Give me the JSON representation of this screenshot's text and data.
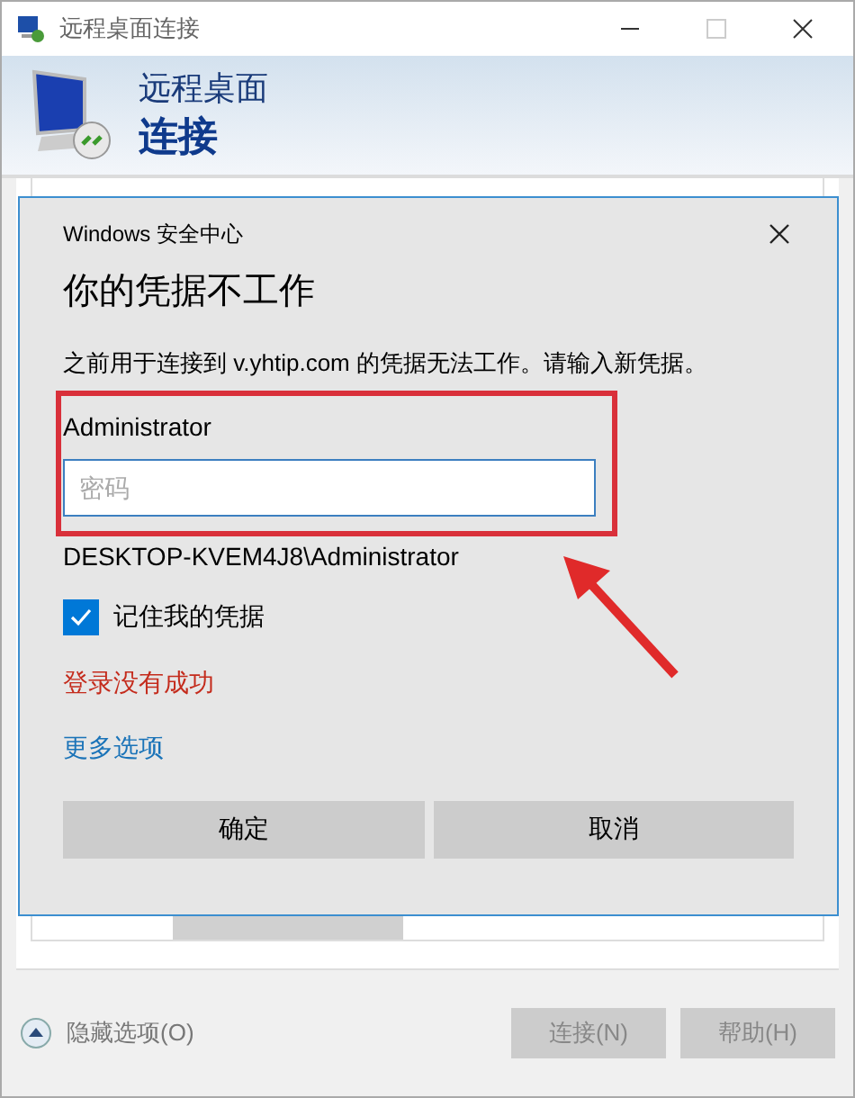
{
  "window": {
    "title": "远程桌面连接",
    "header_line1": "远程桌面",
    "header_line2": "连接"
  },
  "dialog": {
    "caption": "Windows 安全中心",
    "heading": "你的凭据不工作",
    "message": "之前用于连接到 v.yhtip.com 的凭据无法工作。请输入新凭据。",
    "username": "Administrator",
    "password": {
      "placeholder": "密码"
    },
    "account": "DESKTOP-KVEM4J8\\Administrator",
    "remember": {
      "label": "记住我的凭据",
      "checked": true
    },
    "error": "登录没有成功",
    "more_options": "更多选项",
    "buttons": [
      {
        "label": "确定"
      },
      {
        "label": "取消"
      }
    ]
  },
  "footer": {
    "toggle": "隐藏选项(O)",
    "buttons": [
      {
        "label": "连接(N)",
        "disabled": true
      },
      {
        "label": "帮助(H)",
        "disabled": true
      }
    ]
  }
}
